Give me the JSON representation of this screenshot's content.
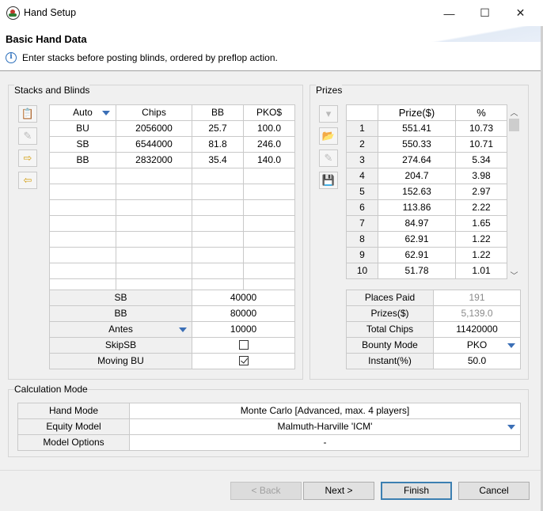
{
  "window": {
    "title": "Hand Setup",
    "minimize": "—",
    "maximize": "☐",
    "close": "✕"
  },
  "header": {
    "title": "Basic Hand Data",
    "message": "Enter stacks before posting blinds, ordered by preflop action."
  },
  "stacks": {
    "group_label": "Stacks and Blinds",
    "columns": [
      "Auto",
      "Chips",
      "BB",
      "PKO$"
    ],
    "rows": [
      [
        "BU",
        "2056000",
        "25.7",
        "100.0"
      ],
      [
        "SB",
        "6544000",
        "81.8",
        "246.0"
      ],
      [
        "BB",
        "2832000",
        "35.4",
        "140.0"
      ],
      [
        "",
        "",
        "",
        ""
      ],
      [
        "",
        "",
        "",
        ""
      ],
      [
        "",
        "",
        "",
        ""
      ],
      [
        "",
        "",
        "",
        ""
      ],
      [
        "",
        "",
        "",
        ""
      ],
      [
        "",
        "",
        "",
        ""
      ],
      [
        "",
        "",
        "",
        ""
      ]
    ],
    "tools": [
      "clipboard-icon",
      "eraser-icon",
      "arrow-right-icon",
      "arrow-left-icon"
    ],
    "params": [
      {
        "label": "SB",
        "value": "40000"
      },
      {
        "label": "BB",
        "value": "80000"
      },
      {
        "label": "Antes",
        "value": "10000"
      },
      {
        "label": "SkipSB",
        "checked": false
      },
      {
        "label": "Moving BU",
        "checked": true
      }
    ]
  },
  "prizes": {
    "group_label": "Prizes",
    "columns": [
      "",
      "Prize($)",
      "%"
    ],
    "rows": [
      [
        "1",
        "551.41",
        "10.73"
      ],
      [
        "2",
        "550.33",
        "10.71"
      ],
      [
        "3",
        "274.64",
        "5.34"
      ],
      [
        "4",
        "204.7",
        "3.98"
      ],
      [
        "5",
        "152.63",
        "2.97"
      ],
      [
        "6",
        "113.86",
        "2.22"
      ],
      [
        "7",
        "84.97",
        "1.65"
      ],
      [
        "8",
        "62.91",
        "1.22"
      ],
      [
        "9",
        "62.91",
        "1.22"
      ],
      [
        "10",
        "51.78",
        "1.01"
      ]
    ],
    "tools": [
      "dropdown-icon",
      "folder-open-icon",
      "eraser-icon",
      "save-icon"
    ],
    "params": [
      {
        "label": "Places Paid",
        "value": "191",
        "muted": true
      },
      {
        "label": "Prizes($)",
        "value": "5,139.0",
        "muted": true
      },
      {
        "label": "Total Chips",
        "value": "11420000"
      },
      {
        "label": "Bounty Mode",
        "value": "PKO"
      },
      {
        "label": "Instant(%)",
        "value": "50.0"
      }
    ]
  },
  "calc": {
    "group_label": "Calculation Mode",
    "rows": [
      {
        "label": "Hand Mode",
        "value": "Monte Carlo [Advanced, max. 4 players]"
      },
      {
        "label": "Equity Model",
        "value": "Malmuth-Harville 'ICM'"
      },
      {
        "label": "Model Options",
        "value": "-"
      }
    ]
  },
  "buttons": {
    "back": "< Back",
    "next": "Next >",
    "finish": "Finish",
    "cancel": "Cancel"
  },
  "colors": {
    "accent": "#3b6fb6",
    "default_button_border": "#3c7fb1"
  }
}
